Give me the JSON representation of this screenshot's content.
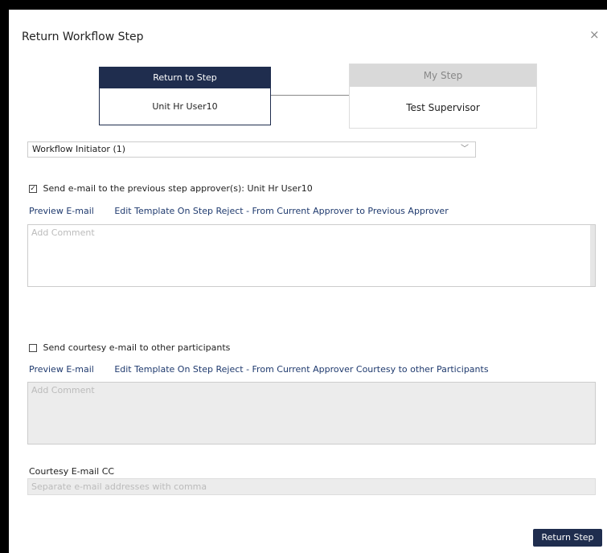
{
  "dialog": {
    "title": "Return Workflow Step",
    "close_glyph": "×"
  },
  "steps": {
    "return_to": {
      "header": "Return to Step",
      "name": "Unit Hr User10"
    },
    "my_step": {
      "header": "My Step",
      "name": "Test Supervisor"
    }
  },
  "step_select": {
    "value": "Workflow Initiator (1)",
    "chevron": "﹀"
  },
  "send_email": {
    "checked": true,
    "checkbox_glyph": "✓",
    "label": "Send e-mail to the previous step approver(s): Unit Hr User10",
    "preview_link": "Preview E-mail",
    "template_link": "Edit Template On Step Reject - From Current Approver to Previous Approver",
    "comment_placeholder": "Add Comment"
  },
  "courtesy_email": {
    "checked": false,
    "label": "Send courtesy e-mail to other participants",
    "preview_link": "Preview E-mail",
    "template_link": "Edit Template On Step Reject - From Current Approver Courtesy to other Participants",
    "comment_placeholder": "Add Comment"
  },
  "cc": {
    "label": "Courtesy E-mail CC",
    "placeholder": "Separate e-mail addresses with comma"
  },
  "footer": {
    "submit_label": "Return Step"
  },
  "colors": {
    "accent": "#1f2d4e",
    "disabled_bg": "#ececec"
  }
}
